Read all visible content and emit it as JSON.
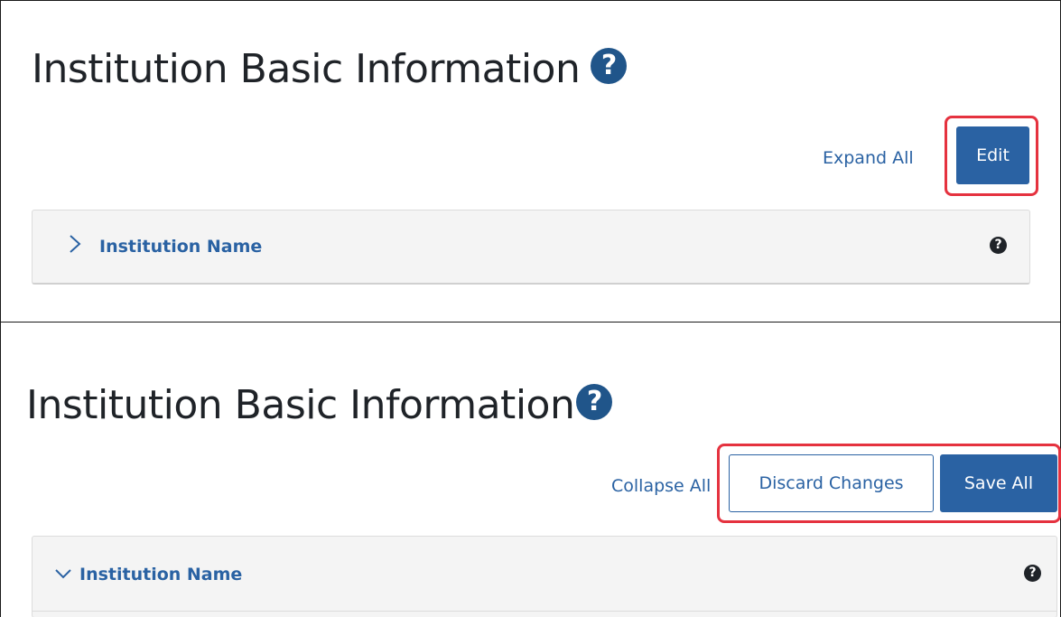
{
  "top_panel": {
    "title": "Institution Basic Information",
    "expand_link": "Expand All",
    "edit_button": "Edit",
    "accordion": {
      "title": "Institution Name",
      "state": "collapsed"
    }
  },
  "bottom_panel": {
    "title": "Institution Basic Information",
    "collapse_link": "Collapse All",
    "discard_button": "Discard Changes",
    "save_button": "Save All",
    "accordion": {
      "title": "Institution Name",
      "state": "expanded"
    }
  },
  "icons": {
    "help": "question-circle-icon",
    "expand": "chevron-right-icon",
    "collapse": "chevron-down-icon"
  },
  "colors": {
    "link": "#2a62a3",
    "primary_button": "#2a62a3",
    "help_icon": "#20558a",
    "highlight": "#e5323f",
    "accordion_bg": "#f4f4f4"
  }
}
